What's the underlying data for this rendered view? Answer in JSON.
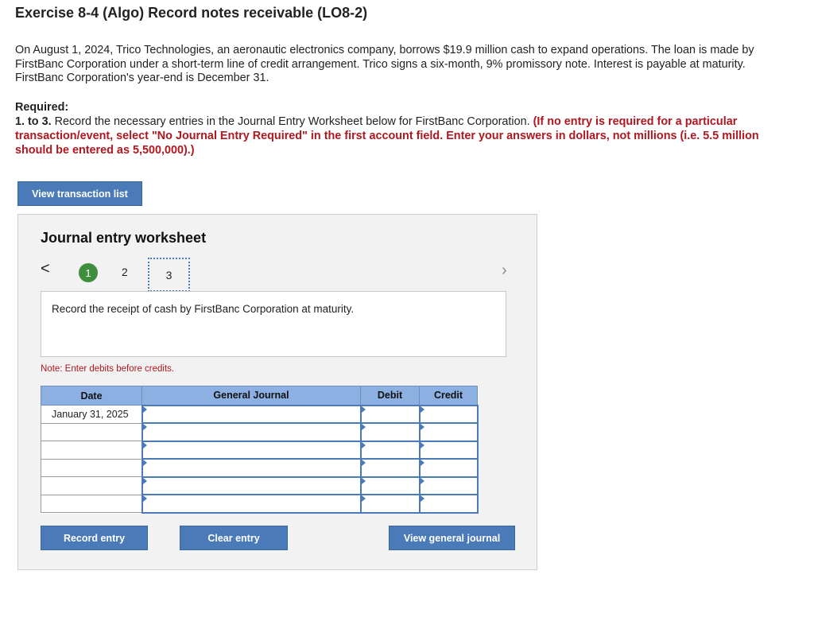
{
  "header": {
    "title": "Exercise 8-4 (Algo) Record notes receivable (LO8-2)"
  },
  "problem": {
    "text": "On August 1, 2024, Trico Technologies, an aeronautic electronics company, borrows $19.9 million cash to expand operations. The loan is made by FirstBanc Corporation under a short-term line of credit arrangement. Trico signs a six-month, 9% promissory note. Interest is payable at maturity. FirstBanc Corporation's year-end is December 31."
  },
  "required": {
    "heading": "Required:",
    "step": "1. to 3.",
    "instruction": "Record the necessary entries in the Journal Entry Worksheet below for FirstBanc Corporation.",
    "note": "(If no entry is required for a particular transaction/event, select \"No Journal Entry Required\" in the first account field. Enter your answers in dollars, not millions (i.e. 5.5 million should be entered as 5,500,000).)"
  },
  "buttons": {
    "view_transaction_list": "View transaction list",
    "record_entry": "Record entry",
    "clear_entry": "Clear entry",
    "view_general_journal": "View general journal"
  },
  "worksheet": {
    "title": "Journal entry worksheet",
    "prev_icon": "<",
    "next_icon": "›",
    "steps": [
      "1",
      "2",
      "3"
    ],
    "active_step": "3",
    "description": "Record the receipt of cash by FirstBanc Corporation at maturity.",
    "note": "Note: Enter debits before credits.",
    "columns": {
      "date": "Date",
      "general_journal": "General Journal",
      "debit": "Debit",
      "credit": "Credit"
    },
    "rows": [
      {
        "date": "January 31, 2025",
        "account": "",
        "debit": "",
        "credit": ""
      },
      {
        "date": "",
        "account": "",
        "debit": "",
        "credit": ""
      },
      {
        "date": "",
        "account": "",
        "debit": "",
        "credit": ""
      },
      {
        "date": "",
        "account": "",
        "debit": "",
        "credit": ""
      },
      {
        "date": "",
        "account": "",
        "debit": "",
        "credit": ""
      },
      {
        "date": "",
        "account": "",
        "debit": "",
        "credit": ""
      }
    ]
  },
  "colors": {
    "button_blue": "#4a7ab8",
    "header_blue": "#8cb0e2",
    "note_red": "#b0171f",
    "step_green": "#3e8e3e"
  }
}
